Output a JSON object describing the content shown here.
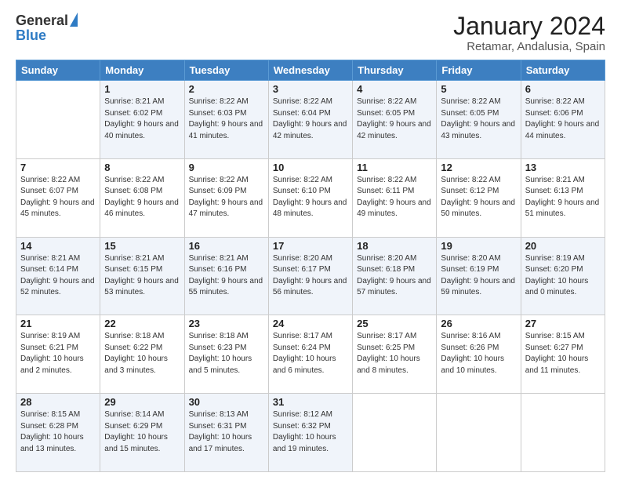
{
  "header": {
    "logo_general": "General",
    "logo_blue": "Blue",
    "month_year": "January 2024",
    "location": "Retamar, Andalusia, Spain"
  },
  "weekdays": [
    "Sunday",
    "Monday",
    "Tuesday",
    "Wednesday",
    "Thursday",
    "Friday",
    "Saturday"
  ],
  "weeks": [
    [
      {
        "day": "",
        "sunrise": "",
        "sunset": "",
        "daylight": ""
      },
      {
        "day": "1",
        "sunrise": "8:21 AM",
        "sunset": "6:02 PM",
        "daylight": "9 hours and 40 minutes."
      },
      {
        "day": "2",
        "sunrise": "8:22 AM",
        "sunset": "6:03 PM",
        "daylight": "9 hours and 41 minutes."
      },
      {
        "day": "3",
        "sunrise": "8:22 AM",
        "sunset": "6:04 PM",
        "daylight": "9 hours and 42 minutes."
      },
      {
        "day": "4",
        "sunrise": "8:22 AM",
        "sunset": "6:05 PM",
        "daylight": "9 hours and 42 minutes."
      },
      {
        "day": "5",
        "sunrise": "8:22 AM",
        "sunset": "6:05 PM",
        "daylight": "9 hours and 43 minutes."
      },
      {
        "day": "6",
        "sunrise": "8:22 AM",
        "sunset": "6:06 PM",
        "daylight": "9 hours and 44 minutes."
      }
    ],
    [
      {
        "day": "7",
        "sunrise": "",
        "sunset": "",
        "daylight": ""
      },
      {
        "day": "8",
        "sunrise": "8:22 AM",
        "sunset": "6:08 PM",
        "daylight": "9 hours and 46 minutes."
      },
      {
        "day": "9",
        "sunrise": "8:22 AM",
        "sunset": "6:09 PM",
        "daylight": "9 hours and 47 minutes."
      },
      {
        "day": "10",
        "sunrise": "8:22 AM",
        "sunset": "6:10 PM",
        "daylight": "9 hours and 48 minutes."
      },
      {
        "day": "11",
        "sunrise": "8:22 AM",
        "sunset": "6:11 PM",
        "daylight": "9 hours and 49 minutes."
      },
      {
        "day": "12",
        "sunrise": "8:22 AM",
        "sunset": "6:12 PM",
        "daylight": "9 hours and 50 minutes."
      },
      {
        "day": "13",
        "sunrise": "8:21 AM",
        "sunset": "6:13 PM",
        "daylight": "9 hours and 51 minutes."
      }
    ],
    [
      {
        "day": "14",
        "sunrise": "8:21 AM",
        "sunset": "6:14 PM",
        "daylight": "9 hours and 52 minutes."
      },
      {
        "day": "15",
        "sunrise": "8:21 AM",
        "sunset": "6:15 PM",
        "daylight": "9 hours and 53 minutes."
      },
      {
        "day": "16",
        "sunrise": "8:21 AM",
        "sunset": "6:16 PM",
        "daylight": "9 hours and 55 minutes."
      },
      {
        "day": "17",
        "sunrise": "8:20 AM",
        "sunset": "6:17 PM",
        "daylight": "9 hours and 56 minutes."
      },
      {
        "day": "18",
        "sunrise": "8:20 AM",
        "sunset": "6:18 PM",
        "daylight": "9 hours and 57 minutes."
      },
      {
        "day": "19",
        "sunrise": "8:20 AM",
        "sunset": "6:19 PM",
        "daylight": "9 hours and 59 minutes."
      },
      {
        "day": "20",
        "sunrise": "8:19 AM",
        "sunset": "6:20 PM",
        "daylight": "10 hours and 0 minutes."
      }
    ],
    [
      {
        "day": "21",
        "sunrise": "8:19 AM",
        "sunset": "6:21 PM",
        "daylight": "10 hours and 2 minutes."
      },
      {
        "day": "22",
        "sunrise": "8:18 AM",
        "sunset": "6:22 PM",
        "daylight": "10 hours and 3 minutes."
      },
      {
        "day": "23",
        "sunrise": "8:18 AM",
        "sunset": "6:23 PM",
        "daylight": "10 hours and 5 minutes."
      },
      {
        "day": "24",
        "sunrise": "8:17 AM",
        "sunset": "6:24 PM",
        "daylight": "10 hours and 6 minutes."
      },
      {
        "day": "25",
        "sunrise": "8:17 AM",
        "sunset": "6:25 PM",
        "daylight": "10 hours and 8 minutes."
      },
      {
        "day": "26",
        "sunrise": "8:16 AM",
        "sunset": "6:26 PM",
        "daylight": "10 hours and 10 minutes."
      },
      {
        "day": "27",
        "sunrise": "8:15 AM",
        "sunset": "6:27 PM",
        "daylight": "10 hours and 11 minutes."
      }
    ],
    [
      {
        "day": "28",
        "sunrise": "8:15 AM",
        "sunset": "6:28 PM",
        "daylight": "10 hours and 13 minutes."
      },
      {
        "day": "29",
        "sunrise": "8:14 AM",
        "sunset": "6:29 PM",
        "daylight": "10 hours and 15 minutes."
      },
      {
        "day": "30",
        "sunrise": "8:13 AM",
        "sunset": "6:31 PM",
        "daylight": "10 hours and 17 minutes."
      },
      {
        "day": "31",
        "sunrise": "8:12 AM",
        "sunset": "6:32 PM",
        "daylight": "10 hours and 19 minutes."
      },
      {
        "day": "",
        "sunrise": "",
        "sunset": "",
        "daylight": ""
      },
      {
        "day": "",
        "sunrise": "",
        "sunset": "",
        "daylight": ""
      },
      {
        "day": "",
        "sunrise": "",
        "sunset": "",
        "daylight": ""
      }
    ]
  ],
  "labels": {
    "sunrise": "Sunrise:",
    "sunset": "Sunset:",
    "daylight": "Daylight:"
  }
}
